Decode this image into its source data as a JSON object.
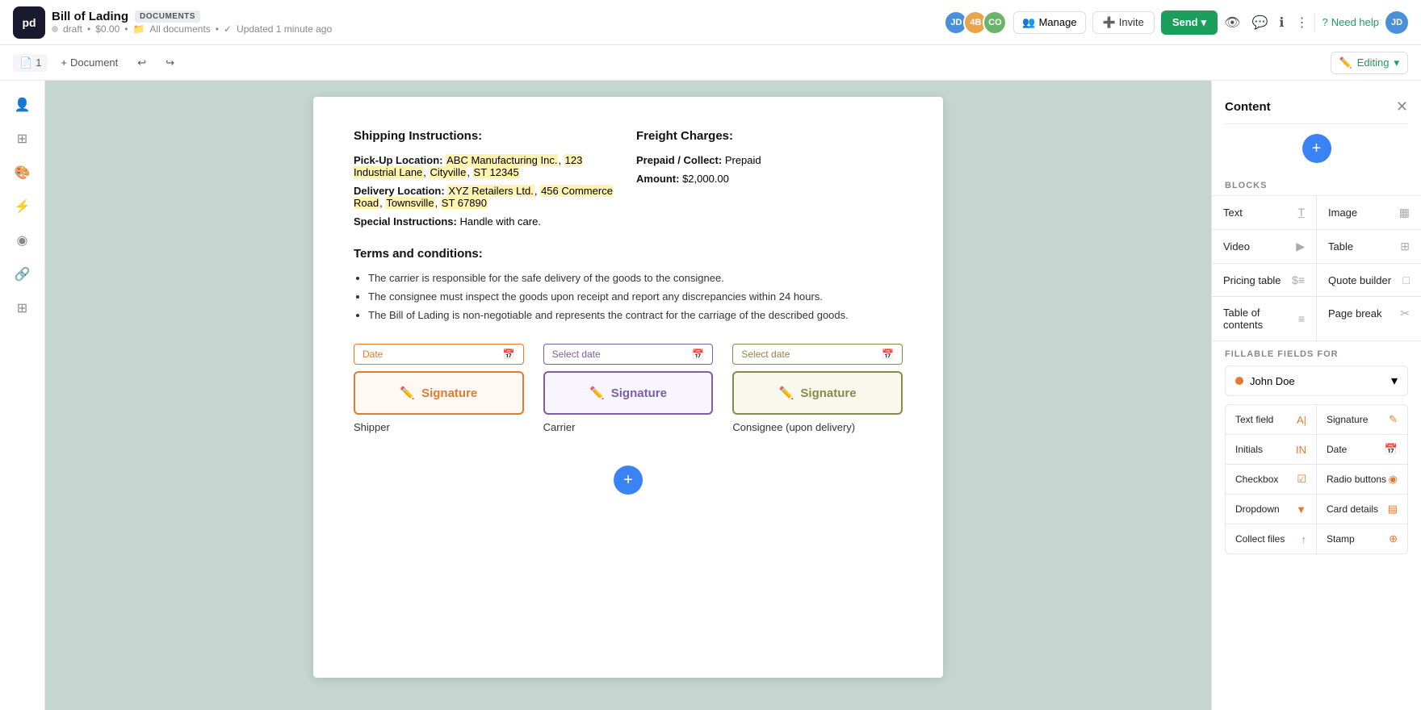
{
  "app": {
    "logo": "pd",
    "title": "Bill of Lading",
    "badge": "DOCUMENTS",
    "status": "draft",
    "price": "$0.00",
    "location": "All documents",
    "updated": "Updated 1 minute ago"
  },
  "topbar": {
    "avatars": [
      {
        "initials": "JD",
        "color": "#4a90d9"
      },
      {
        "initials": "4B",
        "color": "#e8a44d"
      },
      {
        "initials": "CO",
        "color": "#6bb56b"
      }
    ],
    "manage_label": "Manage",
    "invite_label": "Invite",
    "send_label": "Send",
    "need_help_label": "Need help",
    "editing_label": "Editing"
  },
  "toolbar": {
    "pages_label": "1",
    "document_label": "Document"
  },
  "document": {
    "shipping_title": "Shipping Instructions:",
    "pickup_label": "Pick-Up Location:",
    "pickup_value": "ABC Manufacturing Inc., 123 Industrial Lane, Cityville, ST 12345",
    "delivery_label": "Delivery Location:",
    "delivery_value": "XYZ Retailers Ltd., 456 Commerce Road, Townsville, ST 67890",
    "special_label": "Special Instructions:",
    "special_value": "Handle with care.",
    "freight_title": "Freight Charges:",
    "prepaid_label": "Prepaid / Collect:",
    "prepaid_value": "Prepaid",
    "amount_label": "Amount:",
    "amount_value": "$2,000.00",
    "terms_title": "Terms and conditions:",
    "terms": [
      "The carrier is responsible for the safe delivery of the goods to the consignee.",
      "The consignee must inspect the goods upon receipt and report any discrepancies within 24 hours.",
      "The Bill of Lading is non-negotiable and represents the contract for the carriage of the described goods."
    ],
    "shipper_label": "Shipper",
    "carrier_label": "Carrier",
    "consignee_label": "Consignee (upon delivery)",
    "date_placeholder": "Date",
    "select_date": "Select date",
    "signature_label": "Signature"
  },
  "content_panel": {
    "title": "Content",
    "blocks_label": "BLOCKS",
    "blocks": [
      {
        "name": "Text",
        "icon": "T"
      },
      {
        "name": "Image",
        "icon": "▦"
      },
      {
        "name": "Video",
        "icon": "▶"
      },
      {
        "name": "Table",
        "icon": "⊞"
      },
      {
        "name": "Pricing table",
        "icon": "$"
      },
      {
        "name": "Quote builder",
        "icon": "□"
      },
      {
        "name": "Table of contents",
        "icon": "≡"
      },
      {
        "name": "Page break",
        "icon": "✂"
      }
    ],
    "fillable_label": "FILLABLE FIELDS FOR",
    "person_name": "John Doe",
    "fields": [
      {
        "name": "Text field",
        "icon": "A"
      },
      {
        "name": "Signature",
        "icon": "✎"
      },
      {
        "name": "Initials",
        "icon": "IN"
      },
      {
        "name": "Date",
        "icon": "📅"
      },
      {
        "name": "Checkbox",
        "icon": "☑"
      },
      {
        "name": "Radio buttons",
        "icon": "◉"
      },
      {
        "name": "Dropdown",
        "icon": "▼"
      },
      {
        "name": "Card details",
        "icon": "▤"
      },
      {
        "name": "Collect files",
        "icon": "↑"
      },
      {
        "name": "Stamp",
        "icon": "⊕"
      }
    ]
  }
}
